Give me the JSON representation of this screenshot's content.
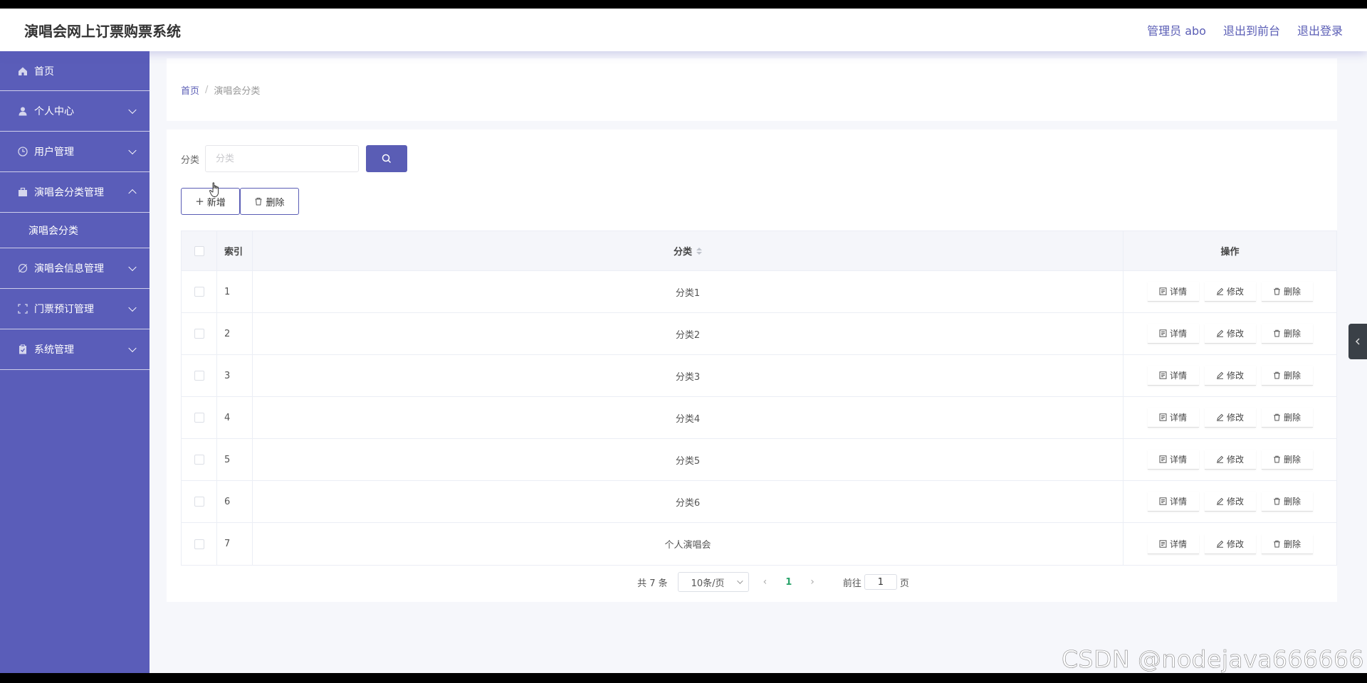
{
  "header": {
    "app_title": "演唱会网上订票购票系统",
    "links": [
      "管理员 abo",
      "退出到前台",
      "退出登录"
    ]
  },
  "sidebar": {
    "items": [
      {
        "label": "首页",
        "icon": "home-icon"
      },
      {
        "label": "个人中心",
        "icon": "user-icon"
      },
      {
        "label": "用户管理",
        "icon": "clock-icon"
      },
      {
        "label": "演唱会分类管理",
        "icon": "briefcase-icon",
        "expanded": true,
        "children": [
          "演唱会分类"
        ]
      },
      {
        "label": "演唱会信息管理",
        "icon": "tag-icon"
      },
      {
        "label": "门票预订管理",
        "icon": "frame-icon"
      },
      {
        "label": "系统管理",
        "icon": "clipboard-icon"
      }
    ]
  },
  "breadcrumb": {
    "home": "首页",
    "separator": "/",
    "current": "演唱会分类"
  },
  "search": {
    "label": "分类",
    "placeholder": "分类",
    "value": ""
  },
  "actions": {
    "add_label": "新增",
    "delete_label": "删除"
  },
  "table": {
    "headers": {
      "index": "索引",
      "category": "分类",
      "ops": "操作"
    },
    "op_labels": {
      "detail": "详情",
      "edit": "修改",
      "delete": "删除"
    },
    "rows": [
      {
        "index": "1",
        "category": "分类1"
      },
      {
        "index": "2",
        "category": "分类2"
      },
      {
        "index": "3",
        "category": "分类3"
      },
      {
        "index": "4",
        "category": "分类4"
      },
      {
        "index": "5",
        "category": "分类5"
      },
      {
        "index": "6",
        "category": "分类6"
      },
      {
        "index": "7",
        "category": "个人演唱会"
      }
    ]
  },
  "pagination": {
    "total_text": "共 7 条",
    "page_size": "10条/页",
    "current_page": "1",
    "goto_prefix": "前往",
    "goto_value": "1",
    "goto_suffix": "页"
  },
  "watermark": "CSDN @nodejava666666",
  "colors": {
    "accent": "#5a5db5",
    "sidebar": "#5a5db9",
    "active_page": "#29a36a"
  }
}
